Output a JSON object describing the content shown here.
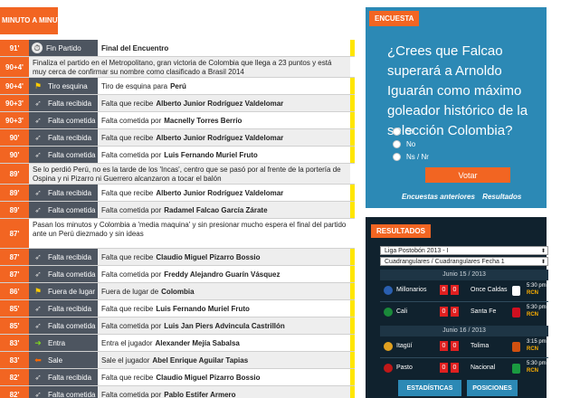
{
  "left_header": "MINUTO A MINUTO",
  "rows": [
    {
      "minute": "91'",
      "icon": "stopwatch-icon",
      "event": "Fin Partido",
      "text": "",
      "bold": "Final del Encuentro",
      "yellow": true,
      "alt": false,
      "type": "event",
      "h": "h19"
    },
    {
      "minute": "90+4'",
      "long": "Finaliza el partido en el Metropolitano, gran victoria de Colombia que llega a 23 puntos y está muy cerca de confirmar su nombre como clasificado a Brasil 2014",
      "yellow": false,
      "alt": true,
      "type": "long",
      "h": "h23"
    },
    {
      "minute": "90+4'",
      "icon": "corner-flag-icon",
      "event": "Tiro esquina",
      "text": "Tiro de esquina para",
      "bold": "Perú",
      "yellow": true,
      "alt": false,
      "type": "event",
      "h": "h19"
    },
    {
      "minute": "90+3'",
      "icon": "whistle-icon",
      "event": "Falta recibida",
      "text": "Falta que recibe",
      "bold": "Alberto Junior Rodríguez Valdelomar",
      "yellow": true,
      "alt": true,
      "type": "event",
      "h": "h19"
    },
    {
      "minute": "90+3'",
      "icon": "whistle-icon",
      "event": "Falta cometida",
      "text": "Falta cometida por",
      "bold": "Macnelly Torres Berrío",
      "yellow": true,
      "alt": false,
      "type": "event",
      "h": "h19"
    },
    {
      "minute": "90'",
      "icon": "whistle-icon",
      "event": "Falta recibida",
      "text": "Falta que recibe",
      "bold": "Alberto Junior Rodríguez Valdelomar",
      "yellow": true,
      "alt": true,
      "type": "event",
      "h": "h19"
    },
    {
      "minute": "90'",
      "icon": "whistle-icon",
      "event": "Falta cometida",
      "text": "Falta cometida por",
      "bold": "Luis Fernando Muriel Fruto",
      "yellow": true,
      "alt": false,
      "type": "event",
      "h": "h19"
    },
    {
      "minute": "89'",
      "long": "Se lo perdió Perú, no es la tarde de los 'Incas', centro que se pasó por al frente de la portería de Ospina y ni Pizarro ni Guerrero alcanzaron a tocar el balón",
      "yellow": false,
      "alt": true,
      "type": "long",
      "h": "h23"
    },
    {
      "minute": "89'",
      "icon": "whistle-icon",
      "event": "Falta recibida",
      "text": "Falta que recibe",
      "bold": "Alberto Junior Rodríguez Valdelomar",
      "yellow": true,
      "alt": false,
      "type": "event",
      "h": "h19"
    },
    {
      "minute": "89'",
      "icon": "whistle-icon",
      "event": "Falta cometida",
      "text": "Falta cometida por",
      "bold": "Radamel Falcao García Zárate",
      "yellow": true,
      "alt": true,
      "type": "event",
      "h": "h19"
    },
    {
      "minute": "87'",
      "long": "Pasan los minutos y Colombia a 'media maquina' y sin presionar mucho espera el final del partido ante un Perú diezmado y sin ideas",
      "yellow": false,
      "alt": false,
      "white": true,
      "type": "long",
      "h": "h33"
    },
    {
      "minute": "87'",
      "icon": "whistle-icon",
      "event": "Falta recibida",
      "text": "Falta que recibe",
      "bold": "Claudio Miguel Pizarro Bossio",
      "yellow": true,
      "alt": true,
      "type": "event",
      "h": "h19"
    },
    {
      "minute": "87'",
      "icon": "whistle-icon",
      "event": "Falta cometida",
      "text": "Falta cometida por",
      "bold": "Freddy Alejandro Guarín Vásquez",
      "yellow": true,
      "alt": false,
      "type": "event",
      "h": "h19"
    },
    {
      "minute": "86'",
      "icon": "offside-flag-icon",
      "event": "Fuera de lugar",
      "text": "Fuera de lugar de",
      "bold": "Colombia",
      "yellow": true,
      "alt": true,
      "type": "event",
      "h": "h19"
    },
    {
      "minute": "85'",
      "icon": "whistle-icon",
      "event": "Falta recibida",
      "text": "Falta que recibe",
      "bold": "Luis Fernando Muriel Fruto",
      "yellow": true,
      "alt": false,
      "type": "event",
      "h": "h19"
    },
    {
      "minute": "85'",
      "icon": "whistle-icon",
      "event": "Falta cometida",
      "text": "Falta cometida por",
      "bold": "Luis Jan Piers Advincula Castrillón",
      "yellow": true,
      "alt": true,
      "type": "event",
      "h": "h19"
    },
    {
      "minute": "83'",
      "icon": "arrow-right-icon",
      "event": "Entra",
      "text": "Entra el jugador",
      "bold": "Alexander Mejía Sabalsa",
      "yellow": true,
      "alt": false,
      "type": "event",
      "h": "h19"
    },
    {
      "minute": "83'",
      "icon": "arrow-left-icon",
      "event": "Sale",
      "text": "Sale el jugador",
      "bold": "Abel Enrique Aguilar Tapias",
      "yellow": true,
      "alt": true,
      "type": "event",
      "h": "h19"
    },
    {
      "minute": "82'",
      "icon": "whistle-icon",
      "event": "Falta recibida",
      "text": "Falta que recibe",
      "bold": "Claudio Miguel Pizarro Bossio",
      "yellow": true,
      "alt": false,
      "type": "event",
      "h": "h19"
    },
    {
      "minute": "82'",
      "icon": "whistle-icon",
      "event": "Falta cometida",
      "text": "Falta cometida por",
      "bold": "Pablo Estifer Armero",
      "yellow": true,
      "alt": true,
      "type": "event",
      "h": "h19"
    }
  ],
  "poll": {
    "tag": "ENCUESTA",
    "question": "¿Crees que Falcao superará a Arnoldo Iguarán como máximo goleador histórico de la selección Colombia?",
    "options": [
      "Sí",
      "No",
      "Ns / Nr"
    ],
    "vote": "Votar",
    "links": [
      "Encuestas anteriores",
      "Resultados"
    ]
  },
  "results": {
    "tag": "RESULTADOS",
    "select1": "Liga Postobón 2013 - I",
    "select2": "Cuadrangulares / Cuadrangulares Fecha 1",
    "dates": [
      "Junio 15 / 2013",
      "Junio 16 / 2013"
    ],
    "matches": [
      {
        "home": "Millonarios",
        "hs": "0",
        "as": "0",
        "away": "Once Caldas",
        "time": "5:30 pm",
        "tv": "RCN",
        "c1": "#2a5fb0",
        "c2": "#ffffff"
      },
      {
        "home": "Cali",
        "hs": "0",
        "as": "0",
        "away": "Santa Fe",
        "time": "5:30 pm",
        "tv": "RCN",
        "c1": "#1a8a3a",
        "c2": "#d01020"
      },
      {
        "home": "Itagüí",
        "hs": "0",
        "as": "0",
        "away": "Tolima",
        "time": "3:15 pm",
        "tv": "RCN",
        "c1": "#e0a020",
        "c2": "#d05010"
      },
      {
        "home": "Pasto",
        "hs": "0",
        "as": "0",
        "away": "Nacional",
        "time": "5:30 pm",
        "tv": "RCN",
        "c1": "#c01818",
        "c2": "#1a9a40"
      }
    ],
    "tabs": [
      "ESTADÍSTICAS",
      "POSICIONES"
    ]
  }
}
